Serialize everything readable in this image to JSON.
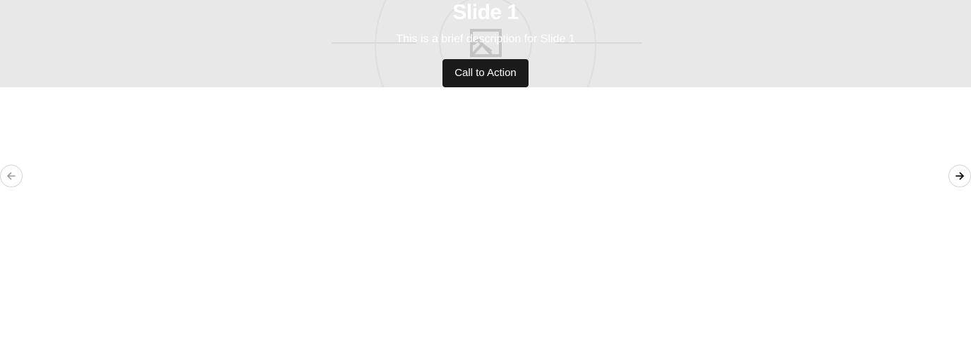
{
  "carousel": {
    "slides": [
      {
        "title": "Slide 1",
        "description": "This is a brief description for Slide 1",
        "cta_label": "Call to Action",
        "image_icon": "image-placeholder-icon"
      }
    ],
    "prev_icon": "arrow-left-icon",
    "next_icon": "arrow-right-icon"
  },
  "colors": {
    "slide_background": "#e8e8e8",
    "cta_background": "#1a1a1a",
    "text_on_slide": "#ffffff",
    "nav_border": "#d6d6d6",
    "prev_icon_disabled": "#9a9a9a",
    "next_icon_active": "#111111"
  }
}
